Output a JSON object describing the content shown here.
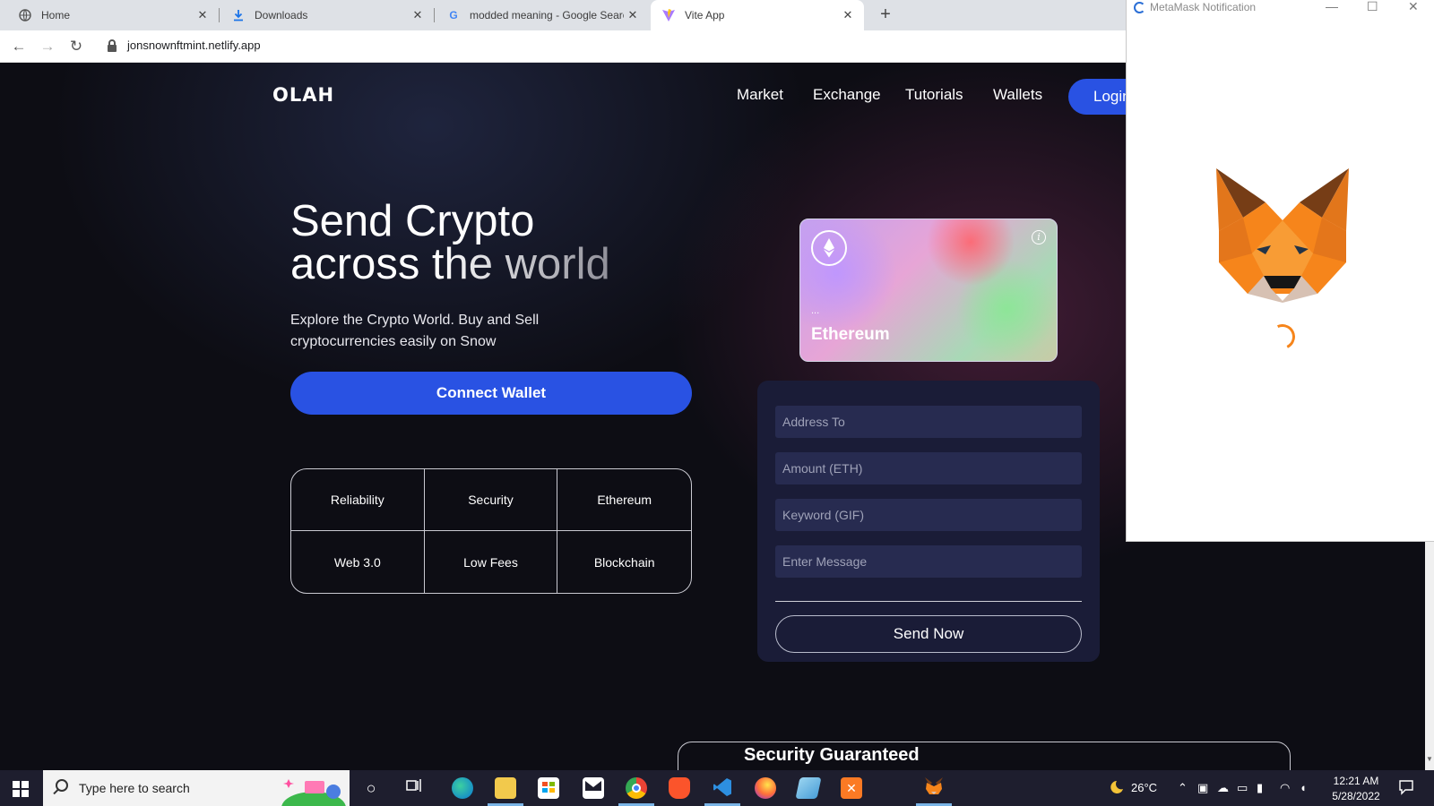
{
  "browser": {
    "tabs": [
      {
        "title": "Home",
        "icon": "globe-icon",
        "active": false
      },
      {
        "title": "Downloads",
        "icon": "download-icon",
        "active": false
      },
      {
        "title": "modded meaning - Google Search",
        "icon": "google-icon",
        "active": false
      },
      {
        "title": "Vite App",
        "icon": "vite-icon",
        "active": true
      }
    ],
    "url": "jonsnownftmint.netlify.app"
  },
  "site": {
    "logo": "OLAH",
    "nav": [
      "Market",
      "Exchange",
      "Tutorials",
      "Wallets"
    ],
    "login_label": "Login",
    "hero_line1": "Send Crypto",
    "hero_line2": "across the world",
    "subtext": "Explore the Crypto World. Buy and Sell cryptocurrencies easily on Snow",
    "connect_label": "Connect Wallet",
    "features": [
      "Reliability",
      "Security",
      "Ethereum",
      "Web 3.0",
      "Low Fees",
      "Blockchain"
    ],
    "card": {
      "address": "...",
      "network": "Ethereum"
    },
    "form": {
      "placeholders": [
        "Address To",
        "Amount (ETH)",
        "Keyword (GIF)",
        "Enter Message"
      ],
      "send_label": "Send Now"
    },
    "bottom_peek": "Security Guaranteed"
  },
  "metamask": {
    "title": "MetaMask Notification"
  },
  "taskbar": {
    "search_placeholder": "Type here to search",
    "weather": "26°C",
    "time": "12:21 AM",
    "date": "5/28/2022"
  },
  "colors": {
    "accent": "#2952e3",
    "form_bg": "#1a1c37",
    "field_bg": "#272b50",
    "metamask_orange": "#f6851b"
  }
}
